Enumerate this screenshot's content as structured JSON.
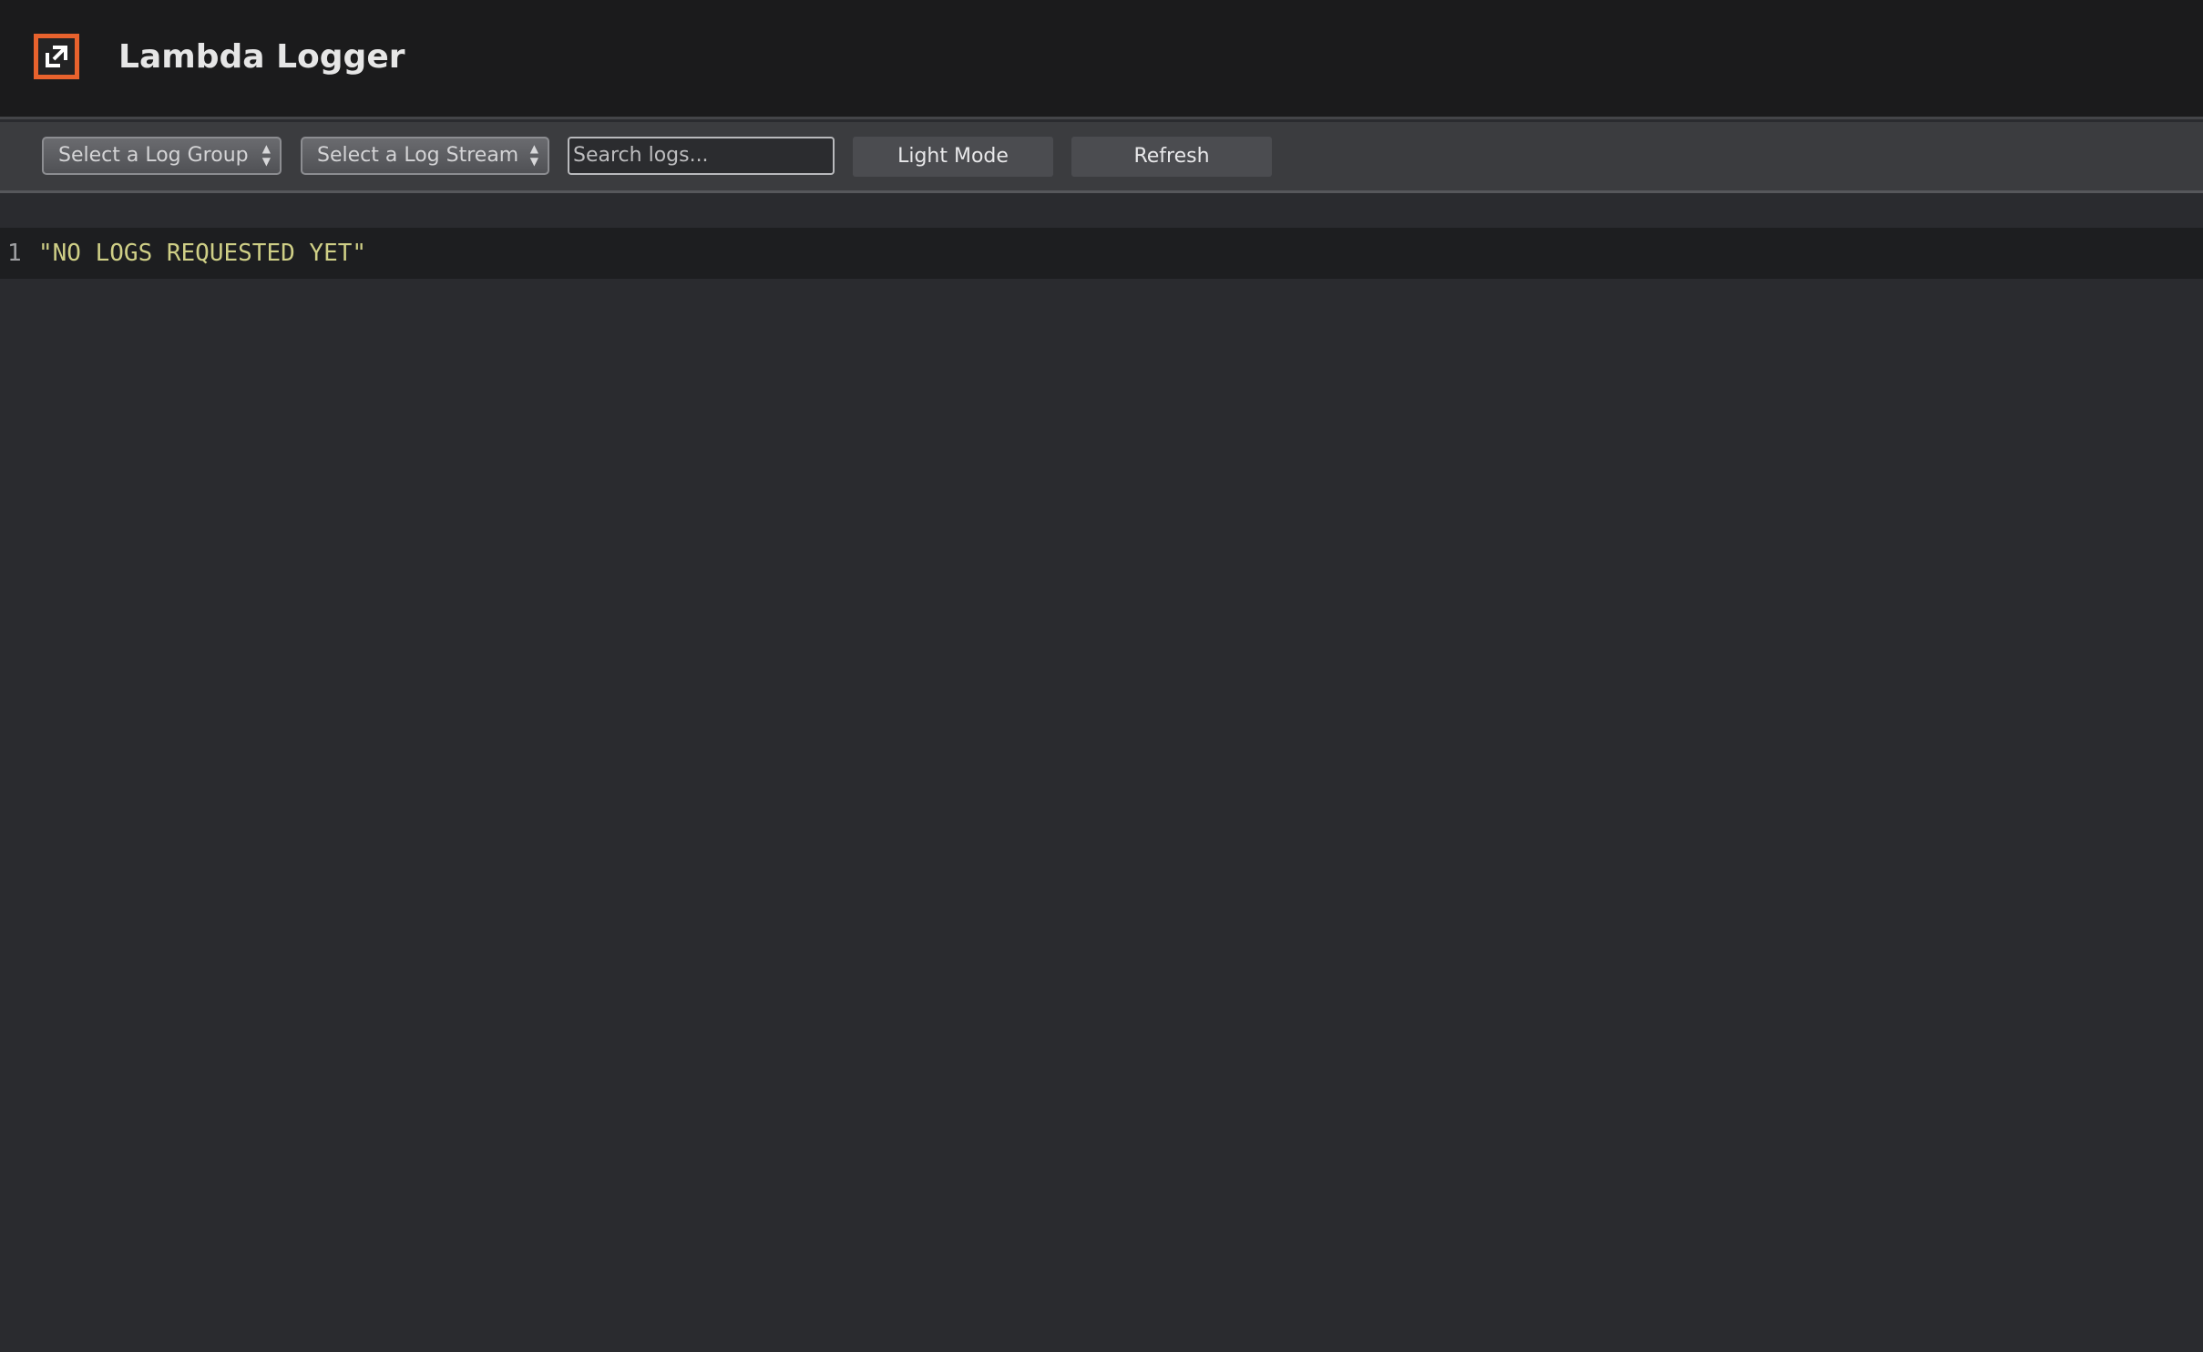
{
  "app": {
    "title": "Lambda Logger",
    "logo_icon": "logo-icon",
    "accent_color": "#e8622d"
  },
  "toolbar": {
    "log_group_select": "Select a Log Group",
    "log_stream_select": "Select a Log Stream",
    "search_placeholder": "Search logs...",
    "theme_button": "Light Mode",
    "refresh_button": "Refresh"
  },
  "editor": {
    "lines": [
      {
        "number": "1",
        "text": "\"NO LOGS REQUESTED YET\""
      }
    ]
  }
}
